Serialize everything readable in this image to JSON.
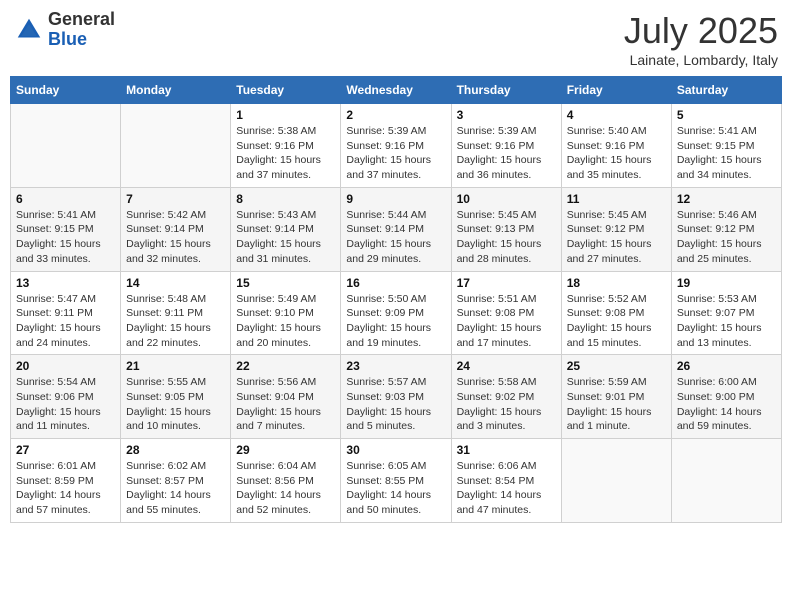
{
  "header": {
    "logo_general": "General",
    "logo_blue": "Blue",
    "month_year": "July 2025",
    "location": "Lainate, Lombardy, Italy"
  },
  "days_of_week": [
    "Sunday",
    "Monday",
    "Tuesday",
    "Wednesday",
    "Thursday",
    "Friday",
    "Saturday"
  ],
  "weeks": [
    [
      {
        "num": "",
        "info": ""
      },
      {
        "num": "",
        "info": ""
      },
      {
        "num": "1",
        "info": "Sunrise: 5:38 AM\nSunset: 9:16 PM\nDaylight: 15 hours\nand 37 minutes."
      },
      {
        "num": "2",
        "info": "Sunrise: 5:39 AM\nSunset: 9:16 PM\nDaylight: 15 hours\nand 37 minutes."
      },
      {
        "num": "3",
        "info": "Sunrise: 5:39 AM\nSunset: 9:16 PM\nDaylight: 15 hours\nand 36 minutes."
      },
      {
        "num": "4",
        "info": "Sunrise: 5:40 AM\nSunset: 9:16 PM\nDaylight: 15 hours\nand 35 minutes."
      },
      {
        "num": "5",
        "info": "Sunrise: 5:41 AM\nSunset: 9:15 PM\nDaylight: 15 hours\nand 34 minutes."
      }
    ],
    [
      {
        "num": "6",
        "info": "Sunrise: 5:41 AM\nSunset: 9:15 PM\nDaylight: 15 hours\nand 33 minutes."
      },
      {
        "num": "7",
        "info": "Sunrise: 5:42 AM\nSunset: 9:14 PM\nDaylight: 15 hours\nand 32 minutes."
      },
      {
        "num": "8",
        "info": "Sunrise: 5:43 AM\nSunset: 9:14 PM\nDaylight: 15 hours\nand 31 minutes."
      },
      {
        "num": "9",
        "info": "Sunrise: 5:44 AM\nSunset: 9:14 PM\nDaylight: 15 hours\nand 29 minutes."
      },
      {
        "num": "10",
        "info": "Sunrise: 5:45 AM\nSunset: 9:13 PM\nDaylight: 15 hours\nand 28 minutes."
      },
      {
        "num": "11",
        "info": "Sunrise: 5:45 AM\nSunset: 9:12 PM\nDaylight: 15 hours\nand 27 minutes."
      },
      {
        "num": "12",
        "info": "Sunrise: 5:46 AM\nSunset: 9:12 PM\nDaylight: 15 hours\nand 25 minutes."
      }
    ],
    [
      {
        "num": "13",
        "info": "Sunrise: 5:47 AM\nSunset: 9:11 PM\nDaylight: 15 hours\nand 24 minutes."
      },
      {
        "num": "14",
        "info": "Sunrise: 5:48 AM\nSunset: 9:11 PM\nDaylight: 15 hours\nand 22 minutes."
      },
      {
        "num": "15",
        "info": "Sunrise: 5:49 AM\nSunset: 9:10 PM\nDaylight: 15 hours\nand 20 minutes."
      },
      {
        "num": "16",
        "info": "Sunrise: 5:50 AM\nSunset: 9:09 PM\nDaylight: 15 hours\nand 19 minutes."
      },
      {
        "num": "17",
        "info": "Sunrise: 5:51 AM\nSunset: 9:08 PM\nDaylight: 15 hours\nand 17 minutes."
      },
      {
        "num": "18",
        "info": "Sunrise: 5:52 AM\nSunset: 9:08 PM\nDaylight: 15 hours\nand 15 minutes."
      },
      {
        "num": "19",
        "info": "Sunrise: 5:53 AM\nSunset: 9:07 PM\nDaylight: 15 hours\nand 13 minutes."
      }
    ],
    [
      {
        "num": "20",
        "info": "Sunrise: 5:54 AM\nSunset: 9:06 PM\nDaylight: 15 hours\nand 11 minutes."
      },
      {
        "num": "21",
        "info": "Sunrise: 5:55 AM\nSunset: 9:05 PM\nDaylight: 15 hours\nand 10 minutes."
      },
      {
        "num": "22",
        "info": "Sunrise: 5:56 AM\nSunset: 9:04 PM\nDaylight: 15 hours\nand 7 minutes."
      },
      {
        "num": "23",
        "info": "Sunrise: 5:57 AM\nSunset: 9:03 PM\nDaylight: 15 hours\nand 5 minutes."
      },
      {
        "num": "24",
        "info": "Sunrise: 5:58 AM\nSunset: 9:02 PM\nDaylight: 15 hours\nand 3 minutes."
      },
      {
        "num": "25",
        "info": "Sunrise: 5:59 AM\nSunset: 9:01 PM\nDaylight: 15 hours\nand 1 minute."
      },
      {
        "num": "26",
        "info": "Sunrise: 6:00 AM\nSunset: 9:00 PM\nDaylight: 14 hours\nand 59 minutes."
      }
    ],
    [
      {
        "num": "27",
        "info": "Sunrise: 6:01 AM\nSunset: 8:59 PM\nDaylight: 14 hours\nand 57 minutes."
      },
      {
        "num": "28",
        "info": "Sunrise: 6:02 AM\nSunset: 8:57 PM\nDaylight: 14 hours\nand 55 minutes."
      },
      {
        "num": "29",
        "info": "Sunrise: 6:04 AM\nSunset: 8:56 PM\nDaylight: 14 hours\nand 52 minutes."
      },
      {
        "num": "30",
        "info": "Sunrise: 6:05 AM\nSunset: 8:55 PM\nDaylight: 14 hours\nand 50 minutes."
      },
      {
        "num": "31",
        "info": "Sunrise: 6:06 AM\nSunset: 8:54 PM\nDaylight: 14 hours\nand 47 minutes."
      },
      {
        "num": "",
        "info": ""
      },
      {
        "num": "",
        "info": ""
      }
    ]
  ]
}
